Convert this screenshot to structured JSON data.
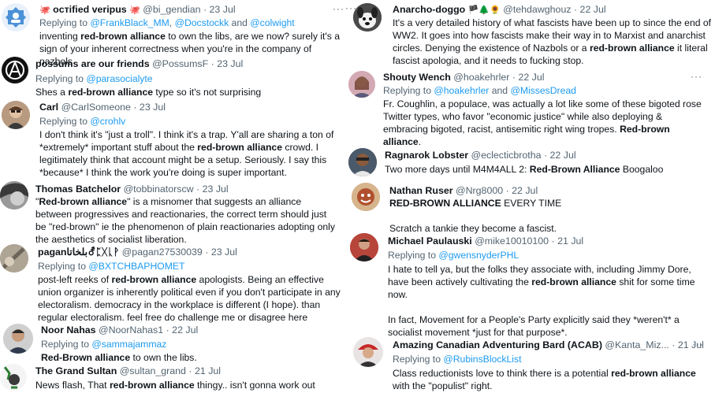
{
  "reply_prefix": "Replying to",
  "left": [
    {
      "name": "ocтified veripus",
      "name_pre": "🐙",
      "name_post": "🐙",
      "handle": "@bi_gendian",
      "date": "23 Jul",
      "replying": [
        "@FrankBlack_MM",
        ", ",
        "@Docstockk",
        " and ",
        "@colwight"
      ],
      "body": [
        [
          "inventing ",
          ""
        ],
        [
          "red-brown alliance",
          "b"
        ],
        [
          " to own the libs, are we now? surely it's a sign of your inherent correctness when you're in the company of nazbols",
          ""
        ]
      ]
    },
    {
      "name": "possums are our friends",
      "handle": "@PossumsF",
      "date": "23 Jul",
      "replying": [
        "@parasocialyte"
      ],
      "body": [
        [
          "Shes a ",
          ""
        ],
        [
          "red-brown alliance",
          "b"
        ],
        [
          " type so it's not surprising",
          ""
        ]
      ]
    },
    {
      "name": "Carl",
      "handle": "@CarlSomeone",
      "date": "23 Jul",
      "replying": [
        "@crohlv"
      ],
      "body": [
        [
          "I don't think it's \"just a troll\". I think it's a trap. Y'all are sharing a ton of *extremely* important stuff about the ",
          ""
        ],
        [
          "red-brown alliance",
          "b"
        ],
        [
          " crowd. I legitimately think that account might be a setup. Seriously. I say this *because* I think the work you're doing is super important.",
          ""
        ]
      ]
    },
    {
      "name": "Thomas Batchelor",
      "handle": "@tobbinatorscw",
      "date": "23 Jul",
      "body": [
        [
          "\"",
          ""
        ],
        [
          "Red-brown alliance",
          "b"
        ],
        [
          "\" is a misnomer that suggests an alliance between progressives and reactionaries, the correct term should just be \"red-brown\" ie the phenomenon of plain reactionaries adopting only the aesthetics of socialist liberation.",
          ""
        ]
      ]
    },
    {
      "name": "paganبلخاتا⚦ᛈᚷᚳᚹ",
      "handle": "@pagan27530039",
      "date": "23 Jul",
      "replying": [
        "@BXTCHBAPHOMET"
      ],
      "body": [
        [
          "post-left reeks of ",
          ""
        ],
        [
          "red-brown alliance",
          "b"
        ],
        [
          " apologists. Being an effective union organizer is inherently political even if you don't participate in any electoralism. democracy in the workplace is different (I hope). than regular electoralism. feel free do challenge me or disagree here",
          ""
        ]
      ]
    },
    {
      "name": "Noor Nahas",
      "handle": "@NoorNahas1",
      "date": "22 Jul",
      "replying": [
        "@sammajammaz"
      ],
      "body": [
        [
          "",
          ""
        ],
        [
          "Red-Brown alliance",
          "b"
        ],
        [
          " to own the libs.",
          ""
        ]
      ]
    },
    {
      "name": "The Grand Sultan",
      "handle": "@sultan_grand",
      "date": "21 Jul",
      "body": [
        [
          "News flash, That ",
          ""
        ],
        [
          "red-brown alliance",
          "b"
        ],
        [
          " thingy.. isn't gonna work out",
          ""
        ]
      ]
    }
  ],
  "right": [
    {
      "name": "Anarcho-doggo",
      "name_post": "🏴🌲🌻",
      "handle": "@tehdawghouz",
      "date": "22 Jul",
      "body": [
        [
          "It's a very detailed history of what fascists have been up to since the end of WW2. It goes into how fascists make their way in to Marxist and anarchist circles. Denying the existence of Nazbols or a ",
          ""
        ],
        [
          "red-brown alliance",
          "b"
        ],
        [
          " it literal fascist apologia, and it needs to fucking stop.",
          ""
        ]
      ]
    },
    {
      "name": "Shouty Wench",
      "handle": "@hoakehrler",
      "date": "22 Jul",
      "replying": [
        "@hoakehrler",
        " and ",
        "@MissesDread"
      ],
      "body": [
        [
          "Fr. Coughlin, a populace, was actually a lot like some of these bigoted rose Twitter types, who favor \"economic justice\" while also deploying & embracing bigoted, racist, antisemitic right wing tropes.  ",
          ""
        ],
        [
          "Red-brown alliance",
          "b"
        ],
        [
          ".",
          ""
        ]
      ]
    },
    {
      "name": "Ragnarok Lobster",
      "handle": "@eclecticbrotha",
      "date": "22 Jul",
      "body": [
        [
          "Two more days until M4M4ALL 2: ",
          ""
        ],
        [
          "Red-Brown Alliance",
          "b"
        ],
        [
          " Boogaloo",
          ""
        ]
      ]
    },
    {
      "name": "Nathan Ruser",
      "handle": "@Nrg8000",
      "date": "22 Jul",
      "body": [
        [
          "",
          ""
        ],
        [
          "RED-BROWN ALLIANCE",
          "b"
        ],
        [
          " EVERY TIME",
          ""
        ]
      ],
      "body2": "Scratch a tankie they become a fascist."
    },
    {
      "name": "Michael Paulauski",
      "handle": "@mike10010100",
      "date": "21 Jul",
      "replying": [
        "@gwensnyderPHL"
      ],
      "body": [
        [
          "I hate to tell ya, but the folks they associate with, including Jimmy Dore, have been actively cultivating the ",
          ""
        ],
        [
          "red-brown alliance",
          "b"
        ],
        [
          " shit for some time now.",
          ""
        ]
      ],
      "body2": "In fact, Movement for a People's Party explicitly said they *weren't* a socialist movement *just for that purpose*."
    },
    {
      "name": "Amazing Canadian Adventuring Bard (ACAB)",
      "handle": "@Kanta_Miz...",
      "date": "21 Jul",
      "replying": [
        "@RubinsBlockList"
      ],
      "body": [
        [
          "Class reductionists love to think there is a potential ",
          ""
        ],
        [
          "red-brown alliance",
          "b"
        ],
        [
          " with the \"populist\" right.",
          ""
        ]
      ]
    }
  ],
  "more_label": "···",
  "sep": " · "
}
